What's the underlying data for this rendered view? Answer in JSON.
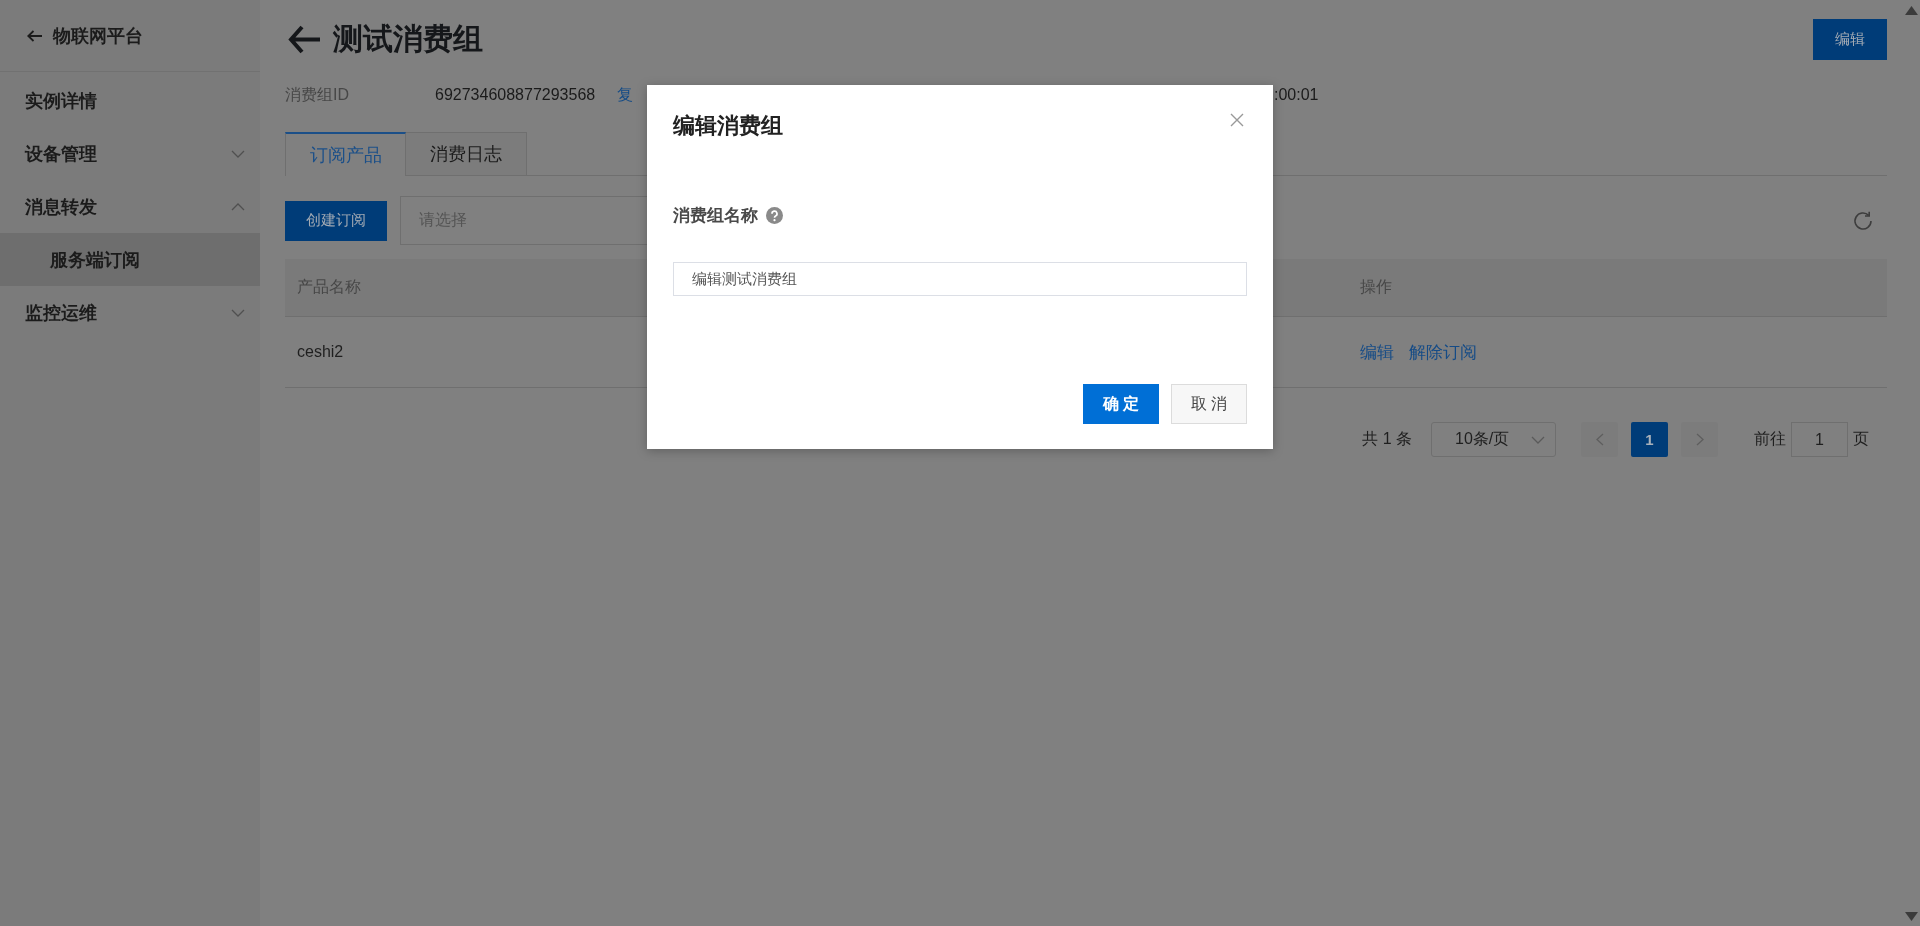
{
  "sidebar": {
    "back_label": "物联网平台",
    "items": [
      {
        "label": "实例详情",
        "kind": "link",
        "selected": false
      },
      {
        "label": "设备管理",
        "kind": "group",
        "expanded": false,
        "selected": false
      },
      {
        "label": "消息转发",
        "kind": "group",
        "expanded": true,
        "selected": false,
        "children": [
          {
            "label": "服务端订阅",
            "selected": true
          }
        ]
      },
      {
        "label": "监控运维",
        "kind": "group",
        "expanded": false,
        "selected": false
      }
    ]
  },
  "header": {
    "title": "测试消费组",
    "edit_button": "编辑"
  },
  "details": {
    "label": "消费组ID",
    "value": "692734608877293568",
    "copy_link": "复",
    "partial_text": ":00:01"
  },
  "tabs": [
    {
      "label": "订阅产品",
      "selected": true
    },
    {
      "label": "消费日志",
      "selected": false
    }
  ],
  "toolbar": {
    "create_button": "创建订阅",
    "product_select": {
      "placeholder": "请选择"
    }
  },
  "table": {
    "columns": [
      "产品名称",
      "操作"
    ],
    "rows": [
      {
        "product_name": "ceshi2",
        "actions": [
          "编辑",
          "解除订阅"
        ]
      }
    ]
  },
  "pagination": {
    "total": "共 1 条",
    "page_size": "10条/页",
    "prev": {
      "disabled": true
    },
    "pages": [
      {
        "label": "1",
        "selected": true
      }
    ],
    "next": {
      "disabled": true
    },
    "goto_label": "前往",
    "goto_value": "1",
    "goto_suffix": "页"
  },
  "dialog": {
    "title": "编辑消费组",
    "field_label": "消费组名称",
    "field_value": "编辑测试消费组",
    "buttons": [
      {
        "label": "确 定",
        "kind": "primary"
      },
      {
        "label": "取 消",
        "kind": "default"
      }
    ]
  }
}
